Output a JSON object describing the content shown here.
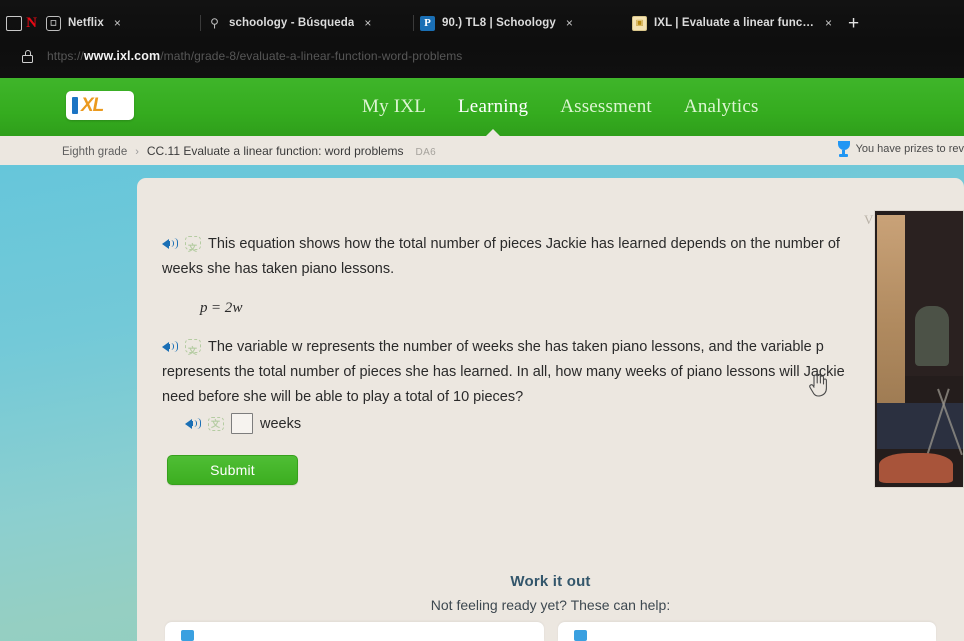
{
  "browser": {
    "window_restore_label": "",
    "tabs": [
      {
        "title": "Netflix",
        "favicon": "netflix-icon",
        "close_label": "×"
      },
      {
        "title": "schoology - Búsqueda",
        "favicon": "search-icon",
        "close_label": "×"
      },
      {
        "title": "90.) TL8 | Schoology",
        "favicon": "schoology-icon",
        "close_label": "×"
      },
      {
        "title": "IXL | Evaluate a linear function: w",
        "favicon": "ixl-icon",
        "close_label": "×"
      }
    ],
    "new_tab_label": "+",
    "url": {
      "scheme": "https://",
      "host": "www.ixl.com",
      "path": "/math/grade-8/evaluate-a-linear-function-word-problems"
    }
  },
  "nav": {
    "logo_mark": "I",
    "logo_text": "XL",
    "links": [
      {
        "label": "My IXL",
        "active": false
      },
      {
        "label": "Learning",
        "active": true
      },
      {
        "label": "Assessment",
        "active": false
      },
      {
        "label": "Analytics",
        "active": false
      }
    ]
  },
  "breadcrumb": {
    "grade": "Eighth grade",
    "separator": "›",
    "skill": "CC.11 Evaluate a linear function: word problems",
    "code": "DA6"
  },
  "prizes": {
    "text": "You have prizes to rev"
  },
  "question": {
    "audio_label": "🔊",
    "translate_label": "文",
    "paragraph1": "This equation shows how the total number of pieces Jackie has learned depends on the number of weeks she has taken piano lessons.",
    "equation_left": "p",
    "equation_op": "=",
    "equation_right": "2w",
    "paragraph2": "The variable w represents the number of weeks she has taken piano lessons, and the variable p represents the total number of pieces she has learned. In all, how many weeks of piano lessons will Jackie need before she will be able to play a total of 10 pieces?",
    "answer_value": "",
    "answer_placeholder": "",
    "answer_unit": "weeks",
    "submit_label": "Submit"
  },
  "work_it_out": {
    "title": "Work it out",
    "subtitle": "Not feeling ready yet? These can help:"
  },
  "video": {
    "label": "V"
  },
  "colors": {
    "ixl_green": "#35ac1f",
    "submit_green": "#3cae20",
    "page_teal": "#73c9d8",
    "card_beige": "#ece7e0",
    "speaker_blue": "#1a6fb5",
    "logo_orange": "#eb9a1f",
    "logo_blue": "#1b74c4"
  }
}
